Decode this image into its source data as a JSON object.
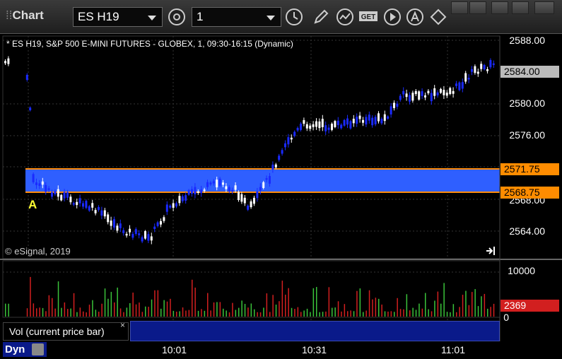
{
  "window": {
    "title": "Chart",
    "symbol": "ES H19",
    "interval": "1"
  },
  "chart": {
    "legend": "* ES H19, S&P 500 E-MINI FUTURES - GLOBEX, 1, 09:30-16:15 (Dynamic)",
    "copyright": "© eSignal, 2019",
    "marker_label": "A",
    "price_axis": [
      "2588.00",
      "2580.00",
      "2576.00",
      "2568.00",
      "2564.00"
    ],
    "current_price": "2584.00",
    "zone_top": "2571.75",
    "zone_bottom": "2568.75",
    "time_axis": [
      "10:01",
      "10:31",
      "11:01"
    ],
    "colors": {
      "zone": "#2f5fff",
      "zone_border": "#ff8c00",
      "up": "#ffffff",
      "down": "#1a2aff"
    }
  },
  "volume": {
    "label": "Vol (current price bar)",
    "close_label": "×",
    "axis": [
      "10000",
      "0"
    ],
    "current_value": "2369",
    "colors": {
      "up": "#3ac23a",
      "down": "#d21f1f"
    }
  },
  "footer": {
    "dyn_label": "Dyn"
  }
}
